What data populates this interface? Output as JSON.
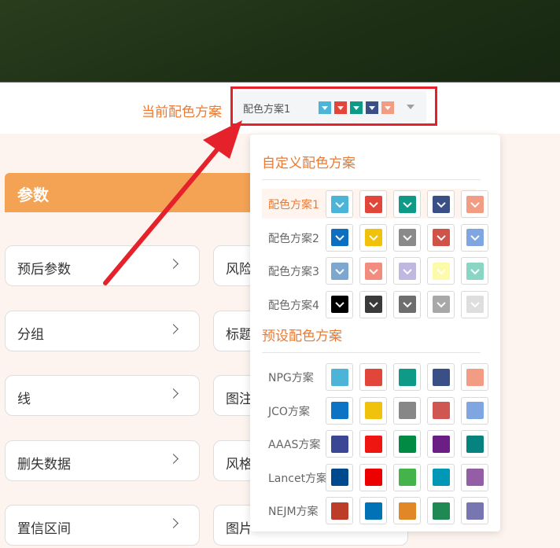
{
  "scheme_bar": {
    "label": "当前配色方案",
    "selected_value": "配色方案1",
    "selected_colors": [
      "#4cb4d6",
      "#e2463b",
      "#0e9a86",
      "#3a4f86",
      "#f39c84"
    ]
  },
  "params": {
    "header": "参数",
    "left_cards": [
      "预后参数",
      "分组",
      "线",
      "删失数据",
      "置信区间"
    ],
    "right_cards": [
      "风险",
      "标题",
      "图注",
      "风格",
      "图片"
    ]
  },
  "dropdown": {
    "custom_title": "自定义配色方案",
    "preset_title": "预设配色方案",
    "custom_schemes": [
      {
        "name": "配色方案1",
        "active": true,
        "colors": [
          "#4cb4d6",
          "#e2463b",
          "#0e9a86",
          "#3a4f86",
          "#f39c84"
        ]
      },
      {
        "name": "配色方案2",
        "active": false,
        "colors": [
          "#0e6ebf",
          "#f0c20c",
          "#8a8a8a",
          "#d0534a",
          "#7fa6e0"
        ]
      },
      {
        "name": "配色方案3",
        "active": false,
        "colors": [
          "#7ea7cf",
          "#f28c7e",
          "#c0b8e0",
          "#fdfbaa",
          "#8ad6c4"
        ]
      },
      {
        "name": "配色方案4",
        "active": false,
        "colors": [
          "#000000",
          "#3a3a3a",
          "#6e6e6e",
          "#a8a8a8",
          "#dedede"
        ]
      }
    ],
    "preset_schemes": [
      {
        "name": "NPG方案",
        "colors": [
          "#4cb4d6",
          "#e2463b",
          "#0e9a86",
          "#3a4f86",
          "#f39c84"
        ]
      },
      {
        "name": "JCO方案",
        "colors": [
          "#0d73c4",
          "#f0c20c",
          "#878787",
          "#cf5651",
          "#7fa6e0"
        ]
      },
      {
        "name": "AAAS方案",
        "colors": [
          "#3b4795",
          "#ef1611",
          "#018a44",
          "#6b1e83",
          "#07837f"
        ]
      },
      {
        "name": "Lancet方案",
        "colors": [
          "#00498d",
          "#ed0000",
          "#43b34a",
          "#0197b6",
          "#945ea7"
        ]
      },
      {
        "name": "NEJM方案",
        "colors": [
          "#bc3c29",
          "#0072b5",
          "#e18728",
          "#208852",
          "#7876b1"
        ]
      }
    ]
  },
  "colors": {
    "accent": "#ea7a32",
    "header_bg": "#f4a254",
    "highlight_red": "#e5212b"
  }
}
